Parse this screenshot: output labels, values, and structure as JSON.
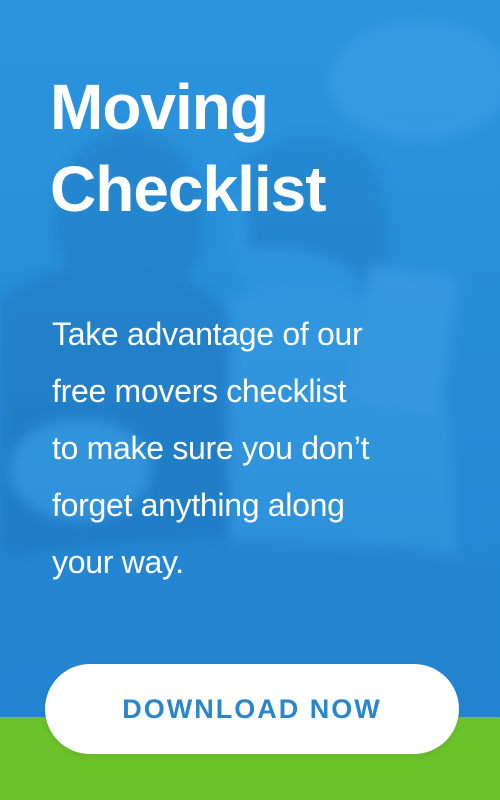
{
  "banner": {
    "title_lines": [
      "Moving",
      "Checklist"
    ],
    "body_lines": [
      "Take advantage of our",
      "free movers checklist",
      "to make sure you don’t",
      "forget anything along",
      "your way."
    ],
    "cta_label": "DOWNLOAD NOW",
    "background_photo": "couple-relaxing-on-couch-with-tablet"
  },
  "colors": {
    "primary_blue": "#2a8fd8",
    "accent_green": "#6cc22a",
    "button_text": "#2b86c9",
    "text": "#ffffff"
  }
}
